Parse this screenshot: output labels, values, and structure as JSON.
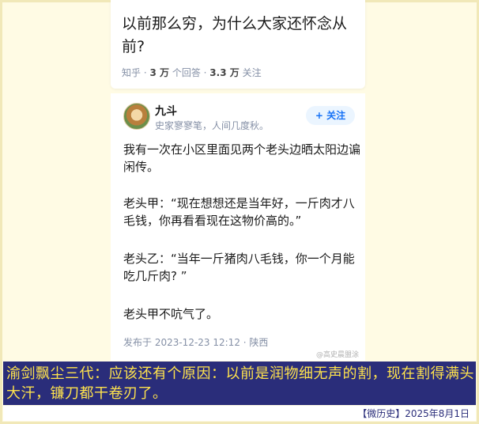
{
  "question": {
    "title": "以前那么穷，为什么大家还怀念从前?",
    "source": "知乎",
    "followers_count": "3 万",
    "followers_label": "个回答",
    "answers_count": "3.3 万",
    "answers_label": "关注"
  },
  "answer": {
    "author_name": "九斗",
    "author_bio": "史家寥寥笔，人间几度秋。",
    "follow_label": "+ 关注",
    "paragraphs": [
      "我有一次在小区里面见两个老头边晒太阳边谝闲传。",
      "老头甲：“现在想想还是当年好，一斤肉才八毛钱，你再看看现在这物价高的。”",
      "老头乙：“当年一斤猪肉八毛钱，你一个月能吃几斤肉? ”",
      "老头甲不吭气了。"
    ],
    "published": "发布于 2023-12-23 12:12 · 陕西",
    "watermark": "@高史晨盟涂"
  },
  "comment": "渝剑飘尘三代：应该还有个原因：以前是润物细无声的割，现在割得满头大汗，镰刀都干卷刃了。",
  "footer": "【微历史】2025年8月1日",
  "colors": {
    "comment_bg": "#2a2d7a",
    "comment_text": "#ffe34d",
    "follow_accent": "#1772f6",
    "frame_bg": "#fffbe4"
  }
}
